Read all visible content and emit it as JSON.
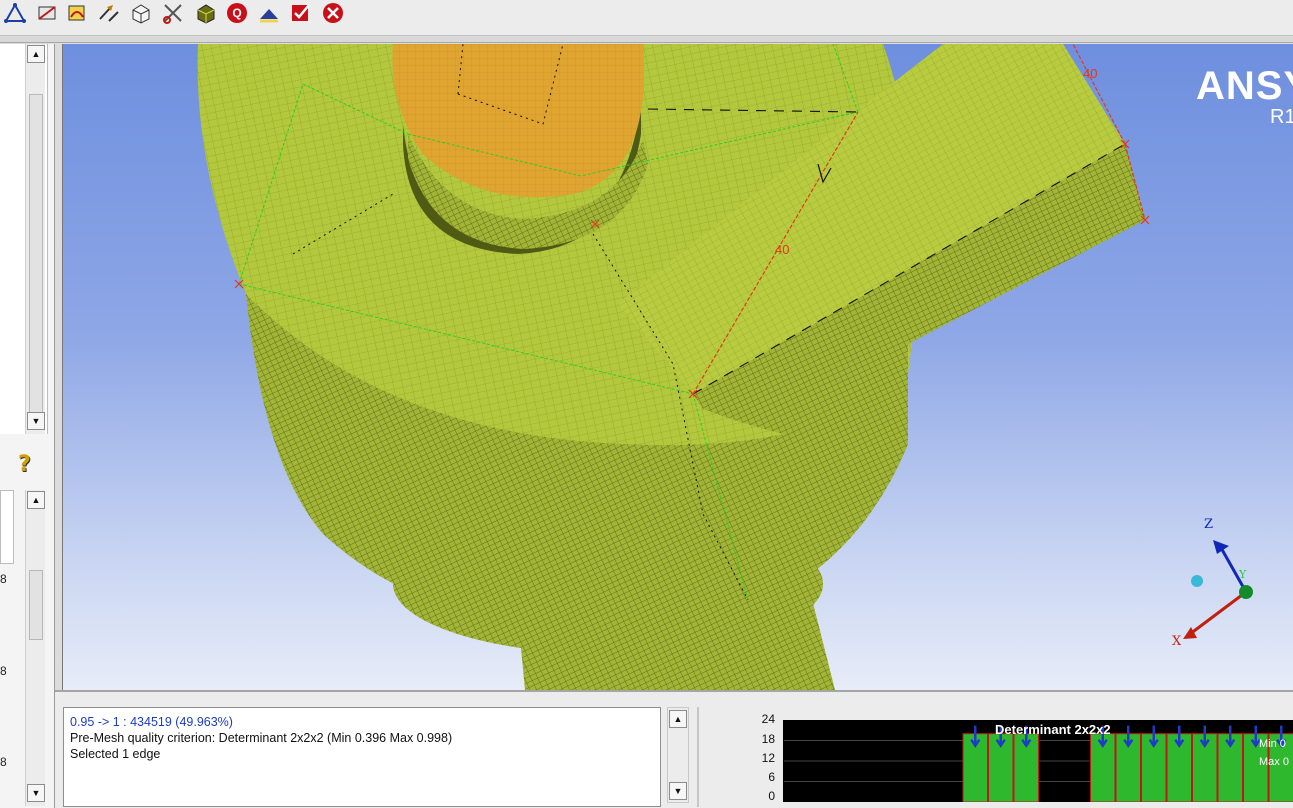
{
  "toolbar": {
    "icons": [
      "mesh-icon",
      "cut-icon",
      "smooth-icon",
      "transform-icon",
      "box-icon",
      "scissors-icon",
      "block-icon",
      "quality-icon",
      "surface-icon",
      "check-icon",
      "cancel-icon"
    ]
  },
  "left_panel": {
    "numbers": [
      "8",
      "8",
      "8"
    ]
  },
  "viewport": {
    "brand": "ANSY",
    "release": "R1",
    "edge_labels": [
      "40",
      "40"
    ],
    "triad": {
      "z": "Z",
      "y": "Y",
      "x": "X"
    },
    "colors": {
      "mesh": "#a9c036",
      "top_face": "#c2d33c",
      "hole": "#e0a431",
      "bg_top": "#6e8fdf",
      "bg_bottom": "#e7ecf8"
    }
  },
  "messages": {
    "lines": [
      "0.95 -> 1 : 434519 (49.963%)",
      "Pre-Mesh quality criterion: Determinant 2x2x2 (Min 0.396 Max 0.998)",
      "Selected 1 edge"
    ]
  },
  "chart_data": {
    "type": "bar",
    "title": "Determinant 2x2x2",
    "yticks": [
      "24",
      "18",
      "12",
      "6",
      "0"
    ],
    "ylim": [
      0,
      24
    ],
    "min_label": "Min 0",
    "max_label": "Max 0",
    "values": [
      0,
      0,
      0,
      0,
      0,
      0,
      0,
      20,
      20,
      20,
      0,
      0,
      20,
      20,
      20,
      20,
      20,
      20,
      20,
      20
    ],
    "colors": {
      "bar": "#2db82d",
      "selected_outline": "#c01818",
      "marker": "#1e3cc8"
    }
  }
}
